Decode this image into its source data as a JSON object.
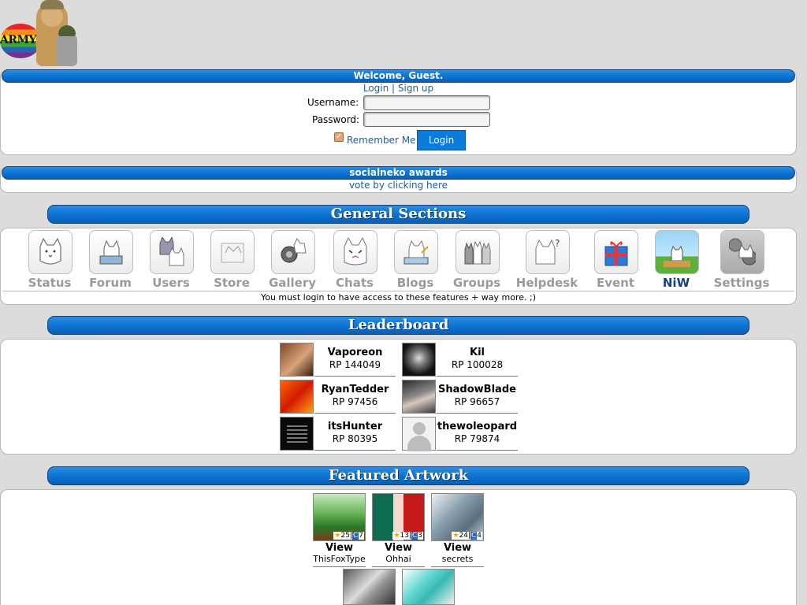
{
  "logo": {
    "text": "ARMY"
  },
  "welcome": {
    "title": "Welcome, Guest.",
    "login_link": "Login",
    "separator": "|",
    "signup_link": "Sign up",
    "username_label": "Username:",
    "password_label": "Password:",
    "username_value": "",
    "password_value": "",
    "remember_label": "Remember Me",
    "remember_checked": true,
    "login_button": "Login"
  },
  "awards": {
    "title": "socialneko awards",
    "link": "vote by clicking here"
  },
  "general": {
    "title": "General Sections",
    "items": [
      {
        "label": "Status",
        "icon": "status-icon"
      },
      {
        "label": "Forum",
        "icon": "forum-icon"
      },
      {
        "label": "Users",
        "icon": "users-icon"
      },
      {
        "label": "Store",
        "icon": "store-icon"
      },
      {
        "label": "Gallery",
        "icon": "gallery-icon"
      },
      {
        "label": "Chats",
        "icon": "chats-icon"
      },
      {
        "label": "Blogs",
        "icon": "blogs-icon"
      },
      {
        "label": "Groups",
        "icon": "groups-icon"
      },
      {
        "label": "Helpdesk",
        "icon": "helpdesk-icon"
      },
      {
        "label": "Event",
        "icon": "gift-icon"
      },
      {
        "label": "NiW",
        "icon": "niw-icon"
      },
      {
        "label": "Settings",
        "icon": "settings-icon"
      }
    ],
    "notice": "You must login to have access to these features + way more. ;)"
  },
  "leaderboard": {
    "title": "Leaderboard",
    "entries": [
      {
        "name": "Vaporeon",
        "rp": "RP 144049"
      },
      {
        "name": "Kil",
        "rp": "RP 100028"
      },
      {
        "name": "RyanTedder",
        "rp": "RP 97456"
      },
      {
        "name": "ShadowBlade",
        "rp": "RP 96657"
      },
      {
        "name": "itsHunter",
        "rp": "RP 80395"
      },
      {
        "name": "thewoleopard",
        "rp": "RP 79874"
      }
    ]
  },
  "featured": {
    "title": "Featured Artwork",
    "items": [
      {
        "view": "View",
        "user": "ThisFoxType",
        "stars": "25",
        "comments": "7"
      },
      {
        "view": "View",
        "user": "Ohhai",
        "stars": "13",
        "comments": "3"
      },
      {
        "view": "View",
        "user": "secrets",
        "stars": "24",
        "comments": "4"
      }
    ]
  },
  "colors": {
    "accent": "#0b72d2",
    "link": "#1b5e9e",
    "background": "#dcdcdc"
  }
}
